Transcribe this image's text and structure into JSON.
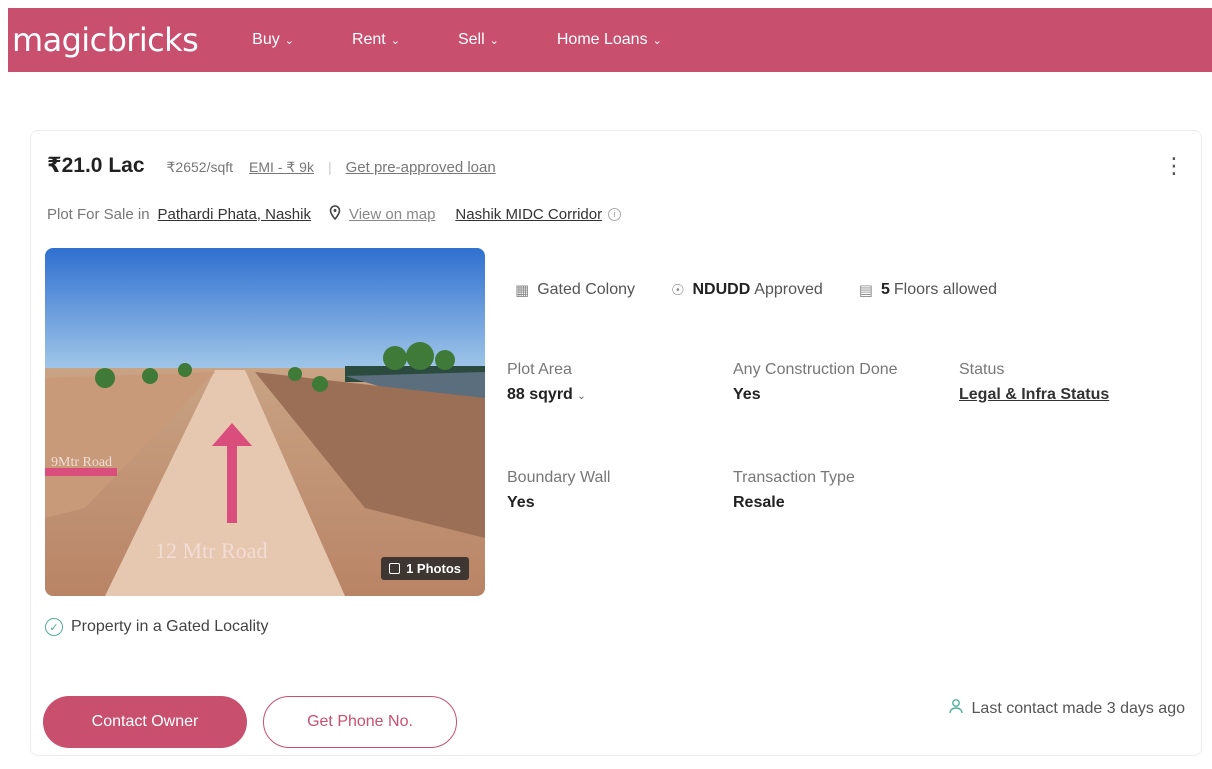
{
  "header": {
    "logo": "magicbricks",
    "nav": [
      {
        "label": "Buy"
      },
      {
        "label": "Rent"
      },
      {
        "label": "Sell"
      },
      {
        "label": "Home Loans"
      }
    ]
  },
  "listing": {
    "price": "₹21.0 Lac",
    "price_per_sqft": "₹2652/sqft",
    "emi": "EMI - ₹ 9k",
    "preapproved": "Get pre-approved loan",
    "location_label": "Plot For Sale in",
    "location": "Pathardi Phata, Nashik",
    "view_map": "View on map",
    "corridor": "Nashik MIDC Corridor",
    "photo": {
      "count_label": "1 Photos",
      "road_label_left": "9Mtr Road",
      "road_label_bottom": "12 Mtr Road"
    },
    "features": [
      {
        "icon": "gated-colony-icon",
        "bold": "",
        "text": "Gated Colony"
      },
      {
        "icon": "shield-check-icon",
        "bold": "NDUDD",
        "text": "Approved"
      },
      {
        "icon": "building-icon",
        "bold": "5",
        "text": "Floors allowed"
      }
    ],
    "attributes": {
      "plot_area": {
        "label": "Plot Area",
        "value": "88 sqyrd"
      },
      "construction": {
        "label": "Any Construction Done",
        "value": "Yes"
      },
      "status": {
        "label": "Status",
        "value": "Legal & Infra Status"
      },
      "boundary": {
        "label": "Boundary Wall",
        "value": "Yes"
      },
      "transaction": {
        "label": "Transaction Type",
        "value": "Resale"
      }
    },
    "gated_note": "Property in a Gated Locality",
    "contact_button": "Contact Owner",
    "phone_button": "Get Phone No.",
    "last_contact": "Last contact made 3 days ago"
  },
  "colors": {
    "brand": "#c94f6f",
    "accent_green": "#4fae9b"
  }
}
